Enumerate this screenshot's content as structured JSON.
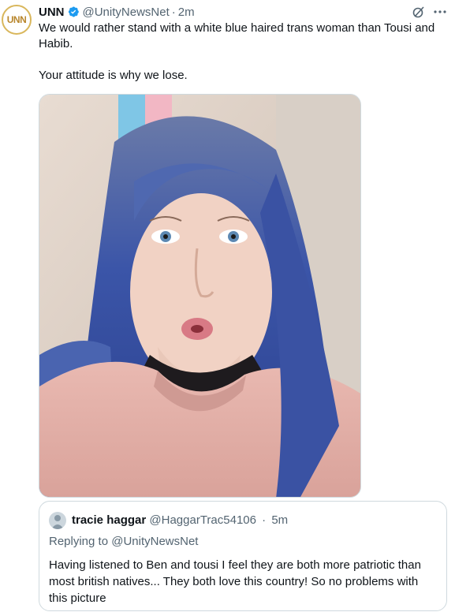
{
  "tweet": {
    "avatar_text": "UNN",
    "author_name": "UNN",
    "handle": "@UnityNewsNet",
    "separator": "·",
    "time": "2m",
    "text_line1": "We would rather stand with a white blue haired trans woman than Tousi and Habib.",
    "text_line2": "Your attitude is why we lose.",
    "photo_description_icon": "selfie-photo",
    "verified_color": "#1d9bf0",
    "accent_gold": "#d9b75c"
  },
  "quote": {
    "author_name": "tracie haggar",
    "handle": "@HaggarTrac54106",
    "separator": "·",
    "time": "5m",
    "replying_prefix": "Replying to ",
    "replying_to": "@UnityNewsNet",
    "text": "Having listened to Ben and tousi I feel they are both more patriotic than most british natives... They both love this country! So no problems with this picture"
  }
}
